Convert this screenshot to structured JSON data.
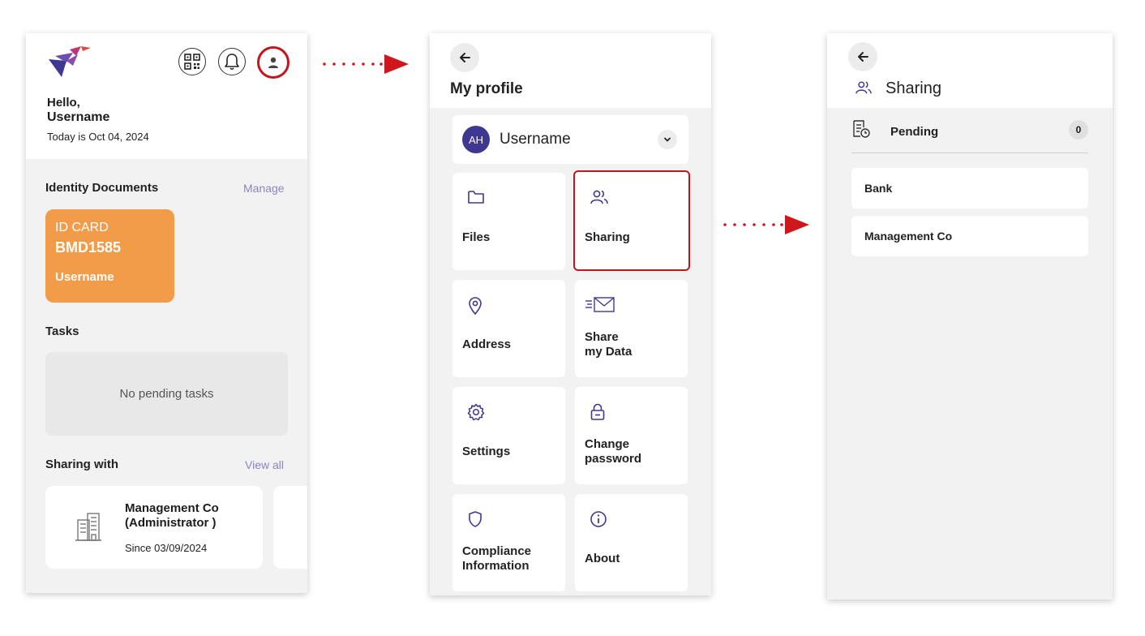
{
  "home": {
    "greeting": "Hello,",
    "username": "Username",
    "today": "Today is Oct 04, 2024",
    "identity_title": "Identity Documents",
    "manage_link": "Manage",
    "id_card": {
      "type": "ID CARD",
      "number": "BMD1585",
      "holder": "Username"
    },
    "tasks_title": "Tasks",
    "tasks_empty": "No pending tasks",
    "sharing_title": "Sharing with",
    "view_all_link": "View all",
    "sharing_card": {
      "name": "Management Co (Administrator )",
      "since": "Since 03/09/2024"
    },
    "icons": [
      "logo-bird-icon",
      "qr-code-icon",
      "bell-icon",
      "profile-icon",
      "building-icon"
    ]
  },
  "profile": {
    "title": "My profile",
    "avatar_initials": "AH",
    "username": "Username",
    "tiles": [
      {
        "label": "Files",
        "icon": "folder-icon"
      },
      {
        "label": "Sharing",
        "icon": "users-icon"
      },
      {
        "label": "Address",
        "icon": "map-pin-icon"
      },
      {
        "label": "Share\nmy Data",
        "icon": "mail-send-icon"
      },
      {
        "label": "Settings",
        "icon": "gear-icon"
      },
      {
        "label": "Change\npassword",
        "icon": "lock-icon"
      },
      {
        "label": "Compliance\nInformation",
        "icon": "shield-icon"
      },
      {
        "label": "About",
        "icon": "info-icon"
      }
    ]
  },
  "sharing": {
    "title": "Sharing",
    "pending_label": "Pending",
    "pending_count": "0",
    "orgs": [
      "Bank",
      "Management Co"
    ]
  },
  "colors": {
    "accent_purple": "#3f3890",
    "link_purple": "#8b84c8",
    "id_card_orange": "#f29b48",
    "highlight_red": "#c4151c"
  }
}
